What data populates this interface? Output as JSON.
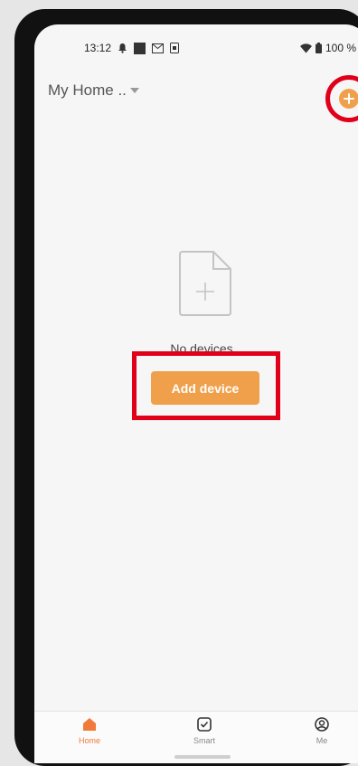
{
  "status_bar": {
    "time": "13:12",
    "battery": "100 %"
  },
  "header": {
    "home_name": "My Home .."
  },
  "empty_state": {
    "message": "No devices",
    "add_button_label": "Add device"
  },
  "bottom_nav": {
    "items": [
      {
        "label": "Home",
        "icon": "home-icon",
        "active": true
      },
      {
        "label": "Smart",
        "icon": "checkbox-icon",
        "active": false
      },
      {
        "label": "Me",
        "icon": "profile-icon",
        "active": false
      }
    ]
  },
  "colors": {
    "accent": "#f0a04b",
    "active_nav": "#f07a3a",
    "highlight": "#e0001a"
  }
}
